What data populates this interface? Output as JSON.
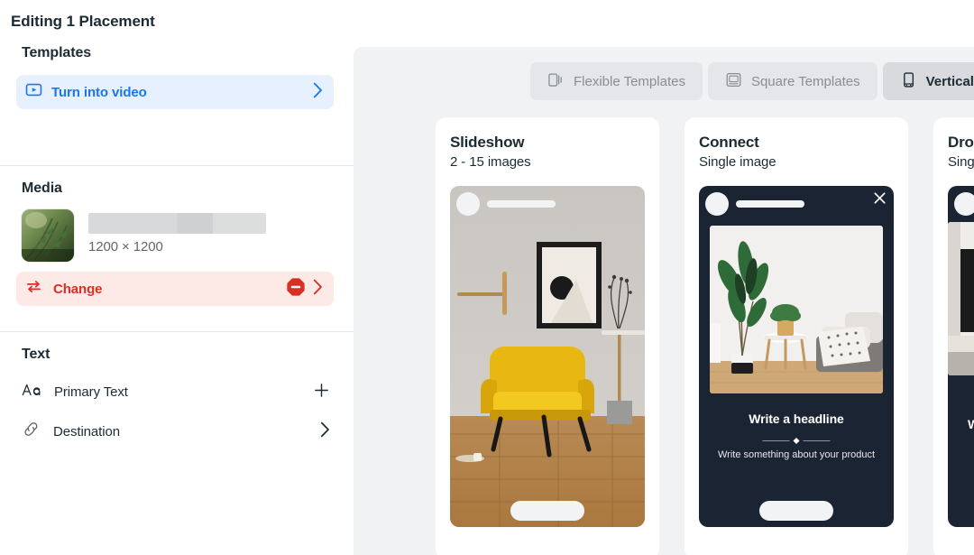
{
  "sidebar": {
    "editing_title": "Editing 1 Placement",
    "templates": {
      "heading": "Templates",
      "turn_into_video": {
        "label": "Turn into video",
        "icon": "play-video-icon",
        "chevron": "›",
        "accent": "#1877f2",
        "background": "#e7f0fe"
      }
    },
    "media": {
      "heading": "Media",
      "thumbnail_alt": "fern-photo-thumbnail",
      "redacted_filename": "",
      "dimensions": "1200 × 1200",
      "change": {
        "label": "Change",
        "icon": "swap-arrows-icon",
        "error_icon": "error-octagon-icon",
        "chevron": "›",
        "accent": "#d93025",
        "background": "#fdeae7"
      }
    },
    "text": {
      "heading": "Text",
      "rows": [
        {
          "label": "Primary Text",
          "icon": "text-format-icon",
          "action": "+",
          "action_icon": "plus-icon"
        },
        {
          "label": "Destination",
          "icon": "link-icon",
          "action": "›",
          "action_icon": "chevron-right-icon"
        }
      ]
    }
  },
  "main": {
    "background": "#f1f2f4",
    "tabs": [
      {
        "label": "Flexible Templates",
        "icon": "flexible-templates-icon",
        "active": false
      },
      {
        "label": "Square Templates",
        "icon": "square-templates-icon",
        "active": false
      },
      {
        "label": "Vertical Templates",
        "icon": "vertical-templates-icon",
        "active": true
      }
    ],
    "cards": [
      {
        "title": "Slideshow",
        "subtitle": "2 - 15 images",
        "preview_kind": "photo-yellow-chair",
        "close_icon": "close-icon"
      },
      {
        "title": "Connect",
        "subtitle": "Single image",
        "preview_kind": "dark-card-living-room",
        "close_icon": "close-icon",
        "headline": "Write a headline",
        "body": "Write something about your product"
      },
      {
        "title": "Drop",
        "subtitle": "Single",
        "preview_kind": "dark-card-bedroom",
        "headline_partial": "W"
      }
    ]
  }
}
